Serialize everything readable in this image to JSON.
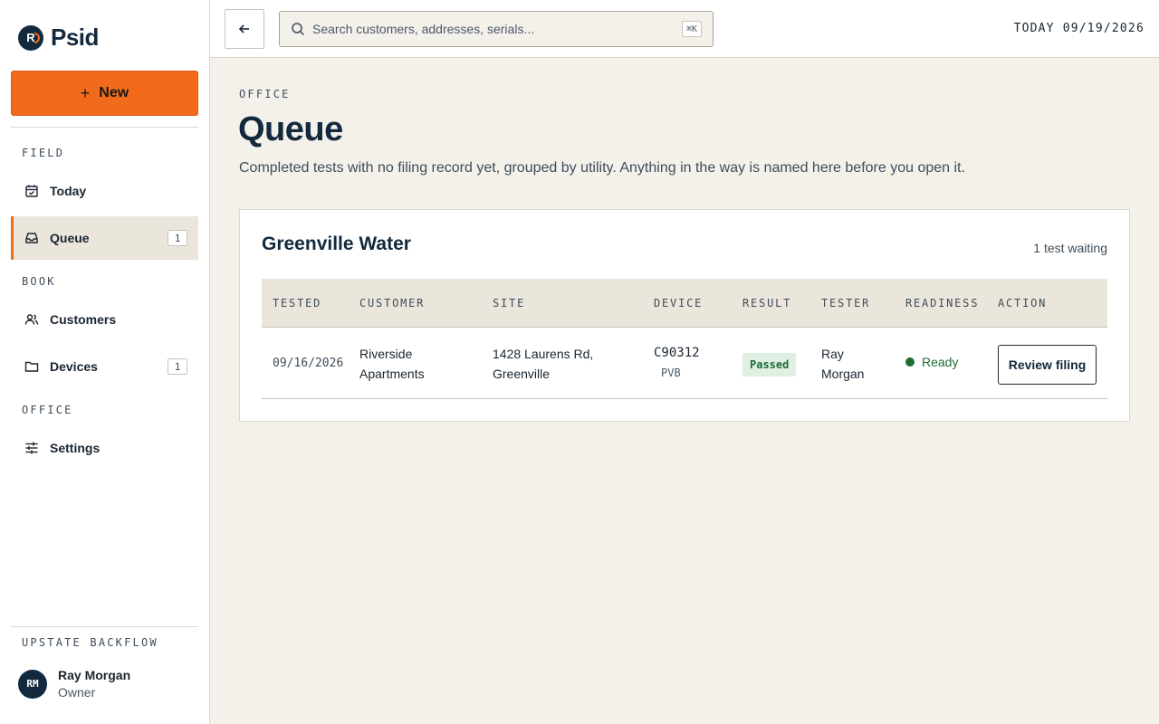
{
  "brand": {
    "name": "Psid",
    "mark": "R"
  },
  "sidebar": {
    "new_label": "New",
    "sections": [
      "FIELD",
      "BOOK",
      "OFFICE"
    ],
    "items": [
      {
        "label": "Today",
        "icon": "calendar-check-icon"
      },
      {
        "label": "Queue",
        "icon": "inbox-icon",
        "count": "1",
        "active": true
      },
      {
        "label": "Customers",
        "icon": "users-icon"
      },
      {
        "label": "Devices",
        "icon": "folder-icon",
        "count": "1"
      },
      {
        "label": "Settings",
        "icon": "sliders-icon"
      }
    ],
    "org": "UPSTATE BACKFLOW",
    "user": {
      "initials": "RM",
      "name": "Ray Morgan",
      "role": "Owner"
    }
  },
  "topbar": {
    "search_placeholder": "Search customers, addresses, serials...",
    "shortcut": "⌘K",
    "today": "TODAY 09/19/2026"
  },
  "page": {
    "eyebrow": "OFFICE",
    "title": "Queue",
    "description": "Completed tests with no filing record yet, grouped by utility. Anything in the way is named here before you open it."
  },
  "group": {
    "title": "Greenville Water",
    "meta": "1 test waiting",
    "columns": [
      "TESTED",
      "CUSTOMER",
      "SITE",
      "DEVICE",
      "RESULT",
      "TESTER",
      "READINESS",
      "ACTION"
    ],
    "rows": [
      {
        "tested": "09/16/2026",
        "customer_line1": "Riverside",
        "customer_line2": "Apartments",
        "site_line1": "1428 Laurens Rd,",
        "site_line2": "Greenville",
        "device_serial": "C90312",
        "device_type": "PVB",
        "result": "Passed",
        "tester_line1": "Ray",
        "tester_line2": "Morgan",
        "readiness": "Ready",
        "action": "Review filing"
      }
    ]
  },
  "colors": {
    "accent": "#f26b1d",
    "navy": "#13293d",
    "success": "#1f6b35",
    "background": "#f4f1eb"
  }
}
